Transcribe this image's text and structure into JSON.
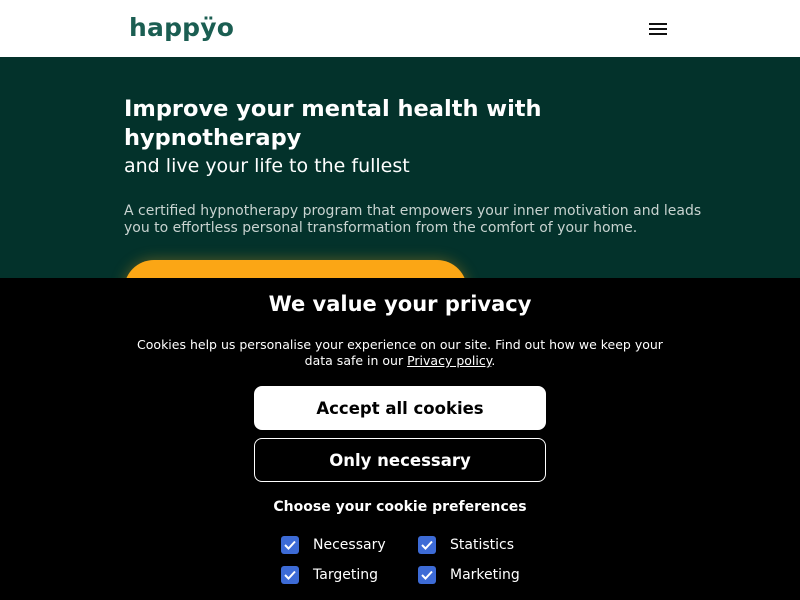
{
  "header": {
    "logo": "happÿo",
    "menu_icon": "hamburger-menu-icon"
  },
  "hero": {
    "title": "Improve your mental health with hypnotherapy",
    "subtitle": "and live your life to the fullest",
    "description": "A certified hypnotherapy program that empowers your inner motivation and leads you to effortless personal transformation from the comfort of your home.",
    "cta_color": "#fba615",
    "background_color": "#03322b"
  },
  "cookie_banner": {
    "title": "We value your privacy",
    "text_before_link": "Cookies help us personalise your experience on our site. Find out how we keep your data safe in our ",
    "link_text": "Privacy policy",
    "text_after_link": ".",
    "accept_label": "Accept all cookies",
    "necessary_label": "Only necessary",
    "preferences_heading": "Choose your cookie preferences",
    "checkbox_color": "#3d6bd6",
    "preferences": [
      {
        "label": "Necessary",
        "checked": true
      },
      {
        "label": "Statistics",
        "checked": true
      },
      {
        "label": "Targeting",
        "checked": true
      },
      {
        "label": "Marketing",
        "checked": true
      }
    ]
  }
}
